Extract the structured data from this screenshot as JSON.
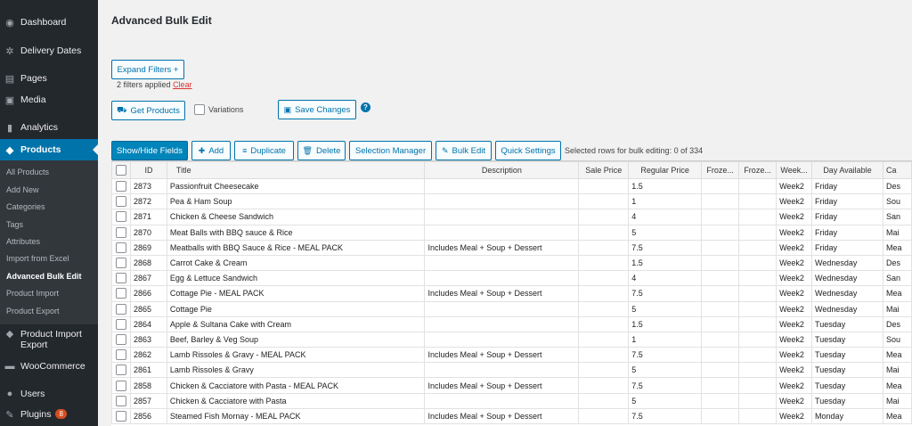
{
  "sidebar": {
    "items": [
      {
        "label": "Dashboard",
        "icon": "dashboard-icon",
        "glyph": "◉"
      },
      {
        "label": "Delivery Dates",
        "icon": "gear-icon",
        "glyph": "✲"
      },
      {
        "label": "Pages",
        "icon": "pages-icon",
        "glyph": "▤"
      },
      {
        "label": "Media",
        "icon": "media-icon",
        "glyph": "▣"
      },
      {
        "label": "Analytics",
        "icon": "analytics-icon",
        "glyph": "▮"
      },
      {
        "label": "Products",
        "icon": "products-icon",
        "glyph": "◆"
      }
    ],
    "submenu": [
      "All Products",
      "Add New",
      "Categories",
      "Tags",
      "Attributes",
      "Import from Excel",
      "Advanced Bulk Edit",
      "Product Import",
      "Product Export"
    ],
    "items_bottom": [
      {
        "label": "Product Import Export",
        "icon": "import-export-icon",
        "glyph": "◆"
      },
      {
        "label": "WooCommerce",
        "icon": "woocommerce-icon",
        "glyph": "▬"
      },
      {
        "label": "Users",
        "icon": "users-icon",
        "glyph": "●"
      },
      {
        "label": "Plugins",
        "icon": "plugins-icon",
        "glyph": "✎",
        "badge": "8"
      }
    ]
  },
  "page": {
    "title": "Advanced Bulk Edit",
    "expand_filters": "Expand Filters +",
    "filters_applied": "2 filters applied",
    "clear": "Clear",
    "get_products": "Get Products",
    "variations": "Variations",
    "save_changes": "Save Changes",
    "help": "?"
  },
  "toolbar": {
    "show_hide": "Show/Hide Fields",
    "add": "Add",
    "duplicate": "Duplicate",
    "delete": "Delete",
    "selection_manager": "Selection Manager",
    "bulk_edit": "Bulk Edit",
    "quick_settings": "Quick Settings",
    "selected_rows": "Selected rows for bulk editing:  0 of 334"
  },
  "table": {
    "columns": [
      "ID",
      "Title",
      "Description",
      "Sale Price",
      "Regular Price",
      "Froze...",
      "Froze...",
      "Week...",
      "Day Available",
      "Ca"
    ],
    "rows": [
      [
        "2873",
        "Passionfruit Cheesecake",
        "",
        "",
        "1.5",
        "",
        "",
        "Week2",
        "Friday",
        "Des"
      ],
      [
        "2872",
        "Pea & Ham Soup",
        "",
        "",
        "1",
        "",
        "",
        "Week2",
        "Friday",
        "Sou"
      ],
      [
        "2871",
        "Chicken & Cheese Sandwich",
        "",
        "",
        "4",
        "",
        "",
        "Week2",
        "Friday",
        "San"
      ],
      [
        "2870",
        "Meat Balls with BBQ sauce & Rice",
        "",
        "",
        "5",
        "",
        "",
        "Week2",
        "Friday",
        "Mai"
      ],
      [
        "2869",
        "Meatballs with BBQ Sauce & Rice - MEAL PACK",
        "Includes Meal + Soup + Dessert",
        "",
        "7.5",
        "",
        "",
        "Week2",
        "Friday",
        "Mea"
      ],
      [
        "2868",
        "Carrot Cake & Cream",
        "",
        "",
        "1.5",
        "",
        "",
        "Week2",
        "Wednesday",
        "Des"
      ],
      [
        "2867",
        "Egg & Lettuce Sandwich",
        "",
        "",
        "4",
        "",
        "",
        "Week2",
        "Wednesday",
        "San"
      ],
      [
        "2866",
        "Cottage Pie - MEAL PACK",
        "Includes Meal + Soup + Dessert",
        "",
        "7.5",
        "",
        "",
        "Week2",
        "Wednesday",
        "Mea"
      ],
      [
        "2865",
        "Cottage Pie",
        "",
        "",
        "5",
        "",
        "",
        "Week2",
        "Wednesday",
        "Mai"
      ],
      [
        "2864",
        "Apple & Sultana Cake with Cream",
        "",
        "",
        "1.5",
        "",
        "",
        "Week2",
        "Tuesday",
        "Des"
      ],
      [
        "2863",
        "Beef, Barley & Veg Soup",
        "",
        "",
        "1",
        "",
        "",
        "Week2",
        "Tuesday",
        "Sou"
      ],
      [
        "2862",
        "Lamb Rissoles & Gravy - MEAL PACK",
        "Includes Meal + Soup + Dessert",
        "",
        "7.5",
        "",
        "",
        "Week2",
        "Tuesday",
        "Mea"
      ],
      [
        "2861",
        "Lamb Rissoles & Gravy",
        "",
        "",
        "5",
        "",
        "",
        "Week2",
        "Tuesday",
        "Mai"
      ],
      [
        "2858",
        "Chicken & Cacciatore with Pasta - MEAL PACK",
        "Includes Meal + Soup + Dessert",
        "",
        "7.5",
        "",
        "",
        "Week2",
        "Tuesday",
        "Mea"
      ],
      [
        "2857",
        "Chicken & Cacciatore with Pasta",
        "",
        "",
        "5",
        "",
        "",
        "Week2",
        "Tuesday",
        "Mai"
      ],
      [
        "2856",
        "Steamed Fish Mornay - MEAL PACK",
        "Includes Meal + Soup + Dessert",
        "",
        "7.5",
        "",
        "",
        "Week2",
        "Monday",
        "Mea"
      ]
    ]
  }
}
